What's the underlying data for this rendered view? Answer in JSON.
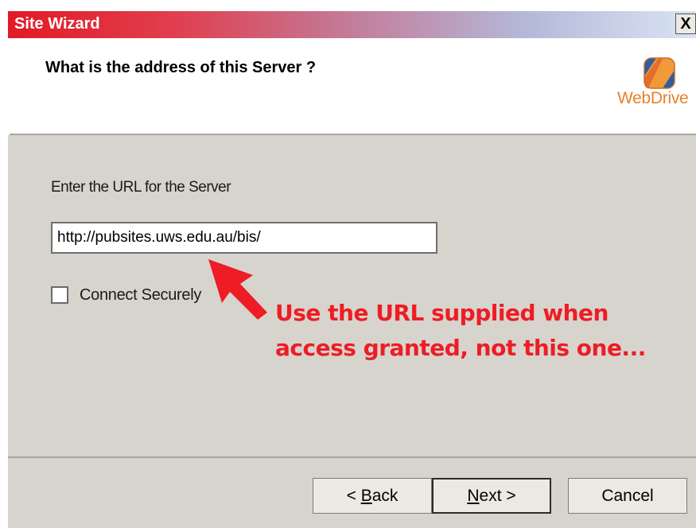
{
  "window": {
    "title": "Site Wizard",
    "close_label": "X"
  },
  "header": {
    "title": "What is the address of this Server ?",
    "logo_text": "WebDrive"
  },
  "form": {
    "url_label": "Enter the URL for the Server",
    "url_value": "http://pubsites.uws.edu.au/bis/",
    "secure_label": "Connect Securely",
    "secure_checked": false
  },
  "annotation": {
    "line1": "Use the URL supplied when",
    "line2": "access granted, not this one...",
    "color": "#ee1c25"
  },
  "buttons": {
    "back": "< Back",
    "next": "Next >",
    "cancel": "Cancel"
  },
  "colors": {
    "title_red": "#e21a26",
    "dialog_gray": "#d7d4cd",
    "logo_orange": "#e8802b",
    "logo_blue": "#2f5e9e"
  }
}
